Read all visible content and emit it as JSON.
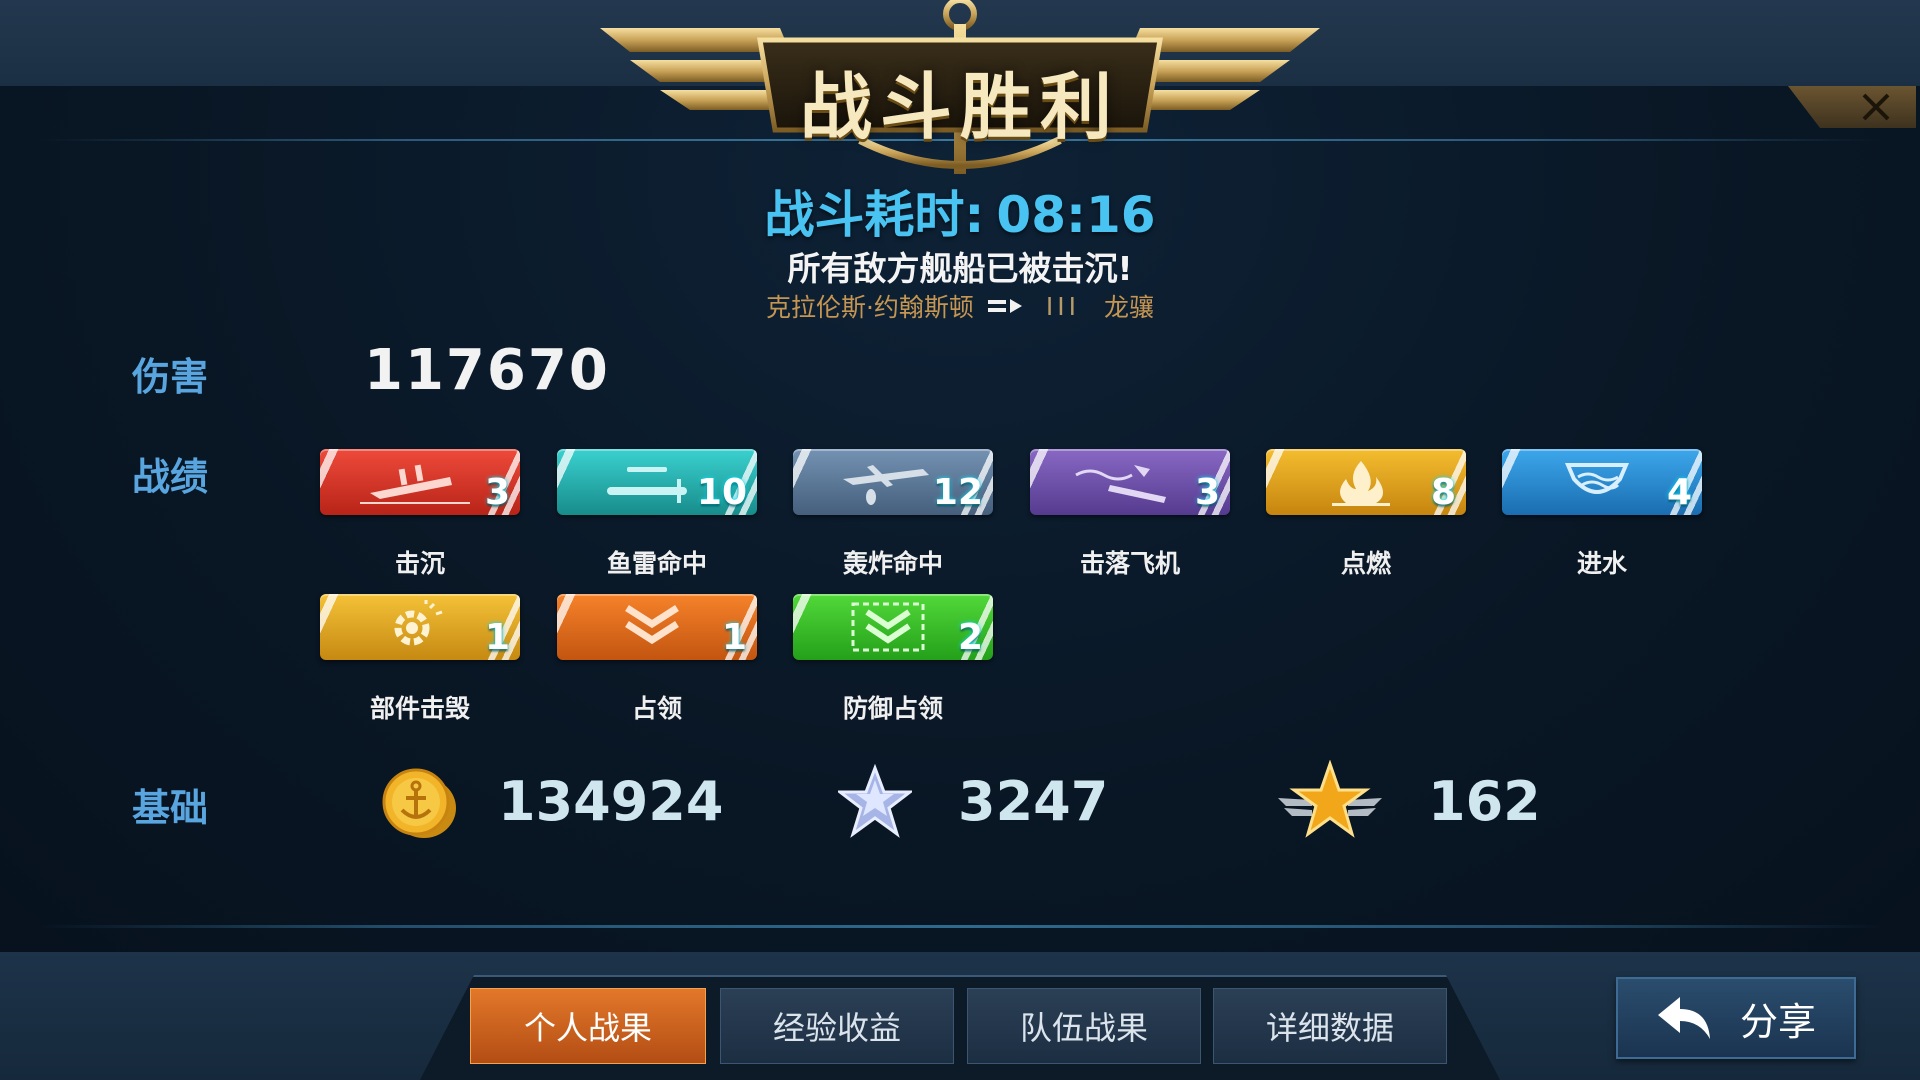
{
  "header": {
    "title": "战斗胜利",
    "time_label": "战斗耗时:",
    "time_value": "08:16",
    "result_message": "所有敌方舰船已被击沉!",
    "ship_name": "克拉伦斯·约翰斯顿",
    "tier": "III",
    "ship_class": "龙骧"
  },
  "damage": {
    "label": "伤害",
    "value": "117670"
  },
  "record": {
    "label": "战绩",
    "badges": [
      {
        "label": "击沉",
        "count": "3",
        "color": "#d9362b",
        "icon": "ship-sink-icon"
      },
      {
        "label": "鱼雷命中",
        "count": "10",
        "color": "#23b1b0",
        "icon": "torpedo-icon"
      },
      {
        "label": "轰炸命中",
        "count": "12",
        "color": "#5c7a99",
        "icon": "bomber-icon"
      },
      {
        "label": "击落飞机",
        "count": "3",
        "color": "#6a4ea8",
        "icon": "plane-shotdown-icon"
      },
      {
        "label": "点燃",
        "count": "8",
        "color": "#e2a319",
        "icon": "fire-icon"
      },
      {
        "label": "进水",
        "count": "4",
        "color": "#2a8fd6",
        "icon": "flooding-icon"
      },
      {
        "label": "部件击毁",
        "count": "1",
        "color": "#e0a613",
        "icon": "gear-destroyed-icon"
      },
      {
        "label": "占领",
        "count": "1",
        "color": "#e07218",
        "icon": "capture-chevron-icon"
      },
      {
        "label": "防御占领",
        "count": "2",
        "color": "#3cc329",
        "icon": "defend-capture-icon"
      }
    ]
  },
  "base": {
    "label": "基础",
    "coins": {
      "value": "134924",
      "icon": "anchor-coin-icon"
    },
    "exp": {
      "value": "3247",
      "icon": "silver-star-icon"
    },
    "commander_exp": {
      "value": "162",
      "icon": "gold-winged-star-icon"
    }
  },
  "tabs": [
    {
      "label": "个人战果",
      "active": true
    },
    {
      "label": "经验收益",
      "active": false
    },
    {
      "label": "队伍战果",
      "active": false
    },
    {
      "label": "详细数据",
      "active": false
    }
  ],
  "share": {
    "label": "分享"
  }
}
